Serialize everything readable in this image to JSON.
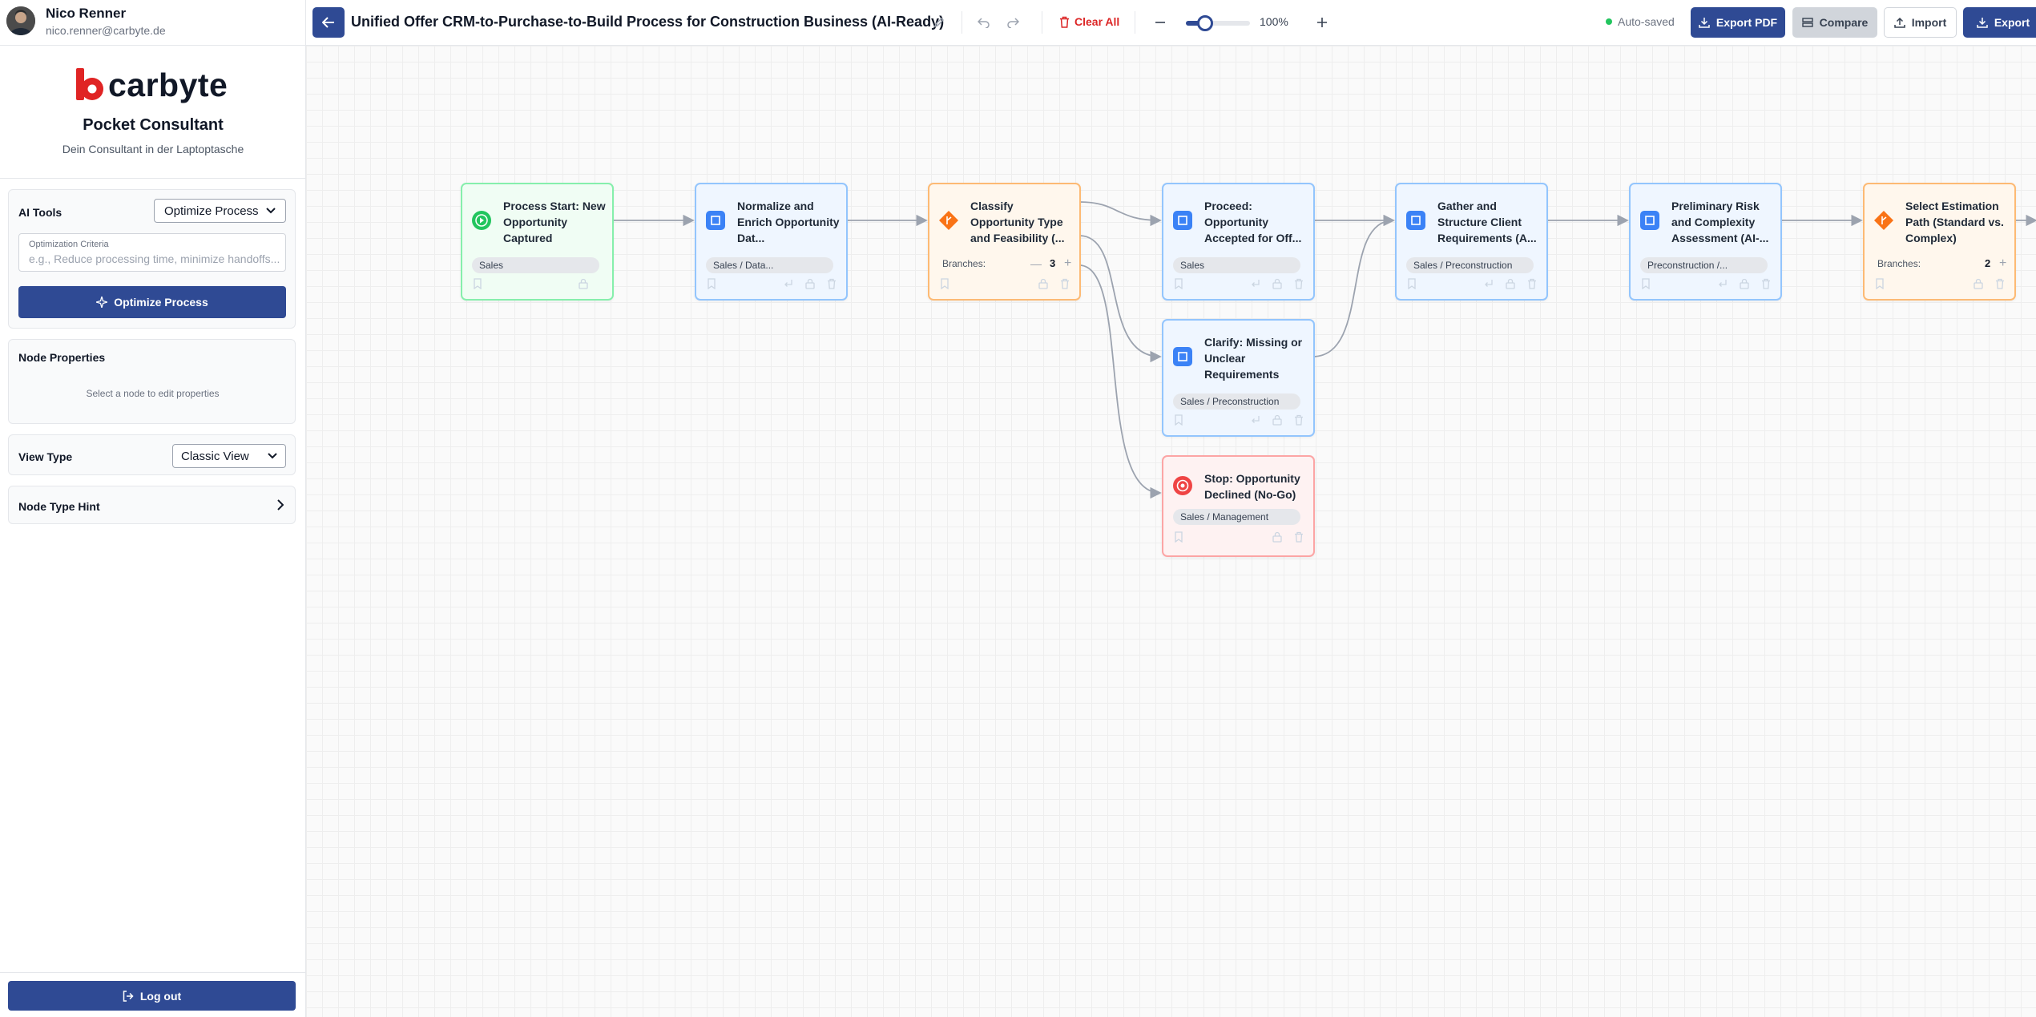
{
  "user": {
    "name": "Nico Renner",
    "email": "nico.renner@carbyte.de"
  },
  "brand": {
    "logo_text": "carbyte",
    "app_name": "Pocket Consultant",
    "tagline": "Dein Consultant in der Laptoptasche",
    "accent": "#e02424"
  },
  "ai_tools": {
    "title": "AI Tools",
    "selected_tool": "Optimize Process",
    "criteria_label": "Optimization Criteria",
    "criteria_placeholder": "e.g., Reduce processing time, minimize handoffs...",
    "optimize_button": "Optimize Process"
  },
  "node_properties": {
    "title": "Node Properties",
    "hint": "Select a node to edit properties"
  },
  "view_type": {
    "title": "View Type",
    "selected": "Classic View"
  },
  "node_type_hint": {
    "title": "Node Type Hint"
  },
  "logout": {
    "label": "Log out"
  },
  "toolbar": {
    "title": "Unified Offer CRM-to-Purchase-to-Build Process for Construction Business (AI-Ready)",
    "clear_all": "Clear All",
    "zoom_fraction": 0.3,
    "zoom_label": "100%",
    "autosave": "Auto-saved",
    "export_pdf": "Export PDF",
    "compare": "Compare",
    "import": "Import",
    "export": "Export"
  },
  "colors": {
    "primary": "#2f4a94",
    "danger": "#dc2626",
    "process": "#3b82f6",
    "start": "#22c55e",
    "decision": "#f97316",
    "stop": "#ef4444"
  },
  "nodes": [
    {
      "type": "start",
      "title": "Process Start: New Opportunity Captured",
      "tag": "Sales"
    },
    {
      "type": "process",
      "title": "Normalize and Enrich Opportunity Dat...",
      "tag": "Sales / Data..."
    },
    {
      "type": "decision",
      "title": "Classify Opportunity Type and Feasibility (...",
      "branches_label": "Branches:",
      "branches": "3"
    },
    {
      "type": "process",
      "title": "Proceed: Opportunity Accepted for Off...",
      "tag": "Sales"
    },
    {
      "type": "process",
      "title": "Clarify: Missing or Unclear Requirements",
      "tag": "Sales / Preconstruction"
    },
    {
      "type": "stop",
      "title": "Stop: Opportunity Declined (No-Go)",
      "tag": "Sales / Management"
    },
    {
      "type": "process",
      "title": "Gather and Structure Client Requirements (A...",
      "tag": "Sales / Preconstruction"
    },
    {
      "type": "process",
      "title": "Preliminary Risk and Complexity Assessment (AI-...",
      "tag": "Preconstruction /..."
    },
    {
      "type": "decision",
      "title": "Select Estimation Path (Standard vs. Complex)",
      "branches_label": "Branches:",
      "branches": "2"
    }
  ]
}
